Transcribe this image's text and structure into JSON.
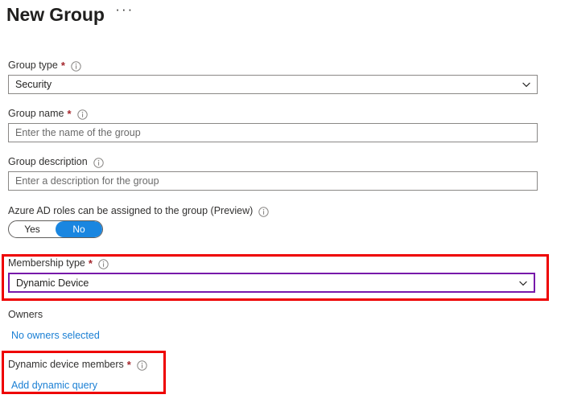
{
  "header": {
    "title": "New Group",
    "more_label": "···"
  },
  "colors": {
    "accent_blue": "#1a86e0",
    "link_blue": "#1a7fd4",
    "required_red": "#a4262c",
    "annotation_red": "#ee0000",
    "focus_purple": "#7719aa",
    "field_border": "#8a8886",
    "text": "#201f1e"
  },
  "form": {
    "group_type": {
      "label": "Group type",
      "required": "*",
      "value": "Security"
    },
    "group_name": {
      "label": "Group name",
      "required": "*",
      "placeholder": "Enter the name of the group",
      "value": ""
    },
    "group_description": {
      "label": "Group description",
      "placeholder": "Enter a description for the group",
      "value": ""
    },
    "azure_ad_roles": {
      "label": "Azure AD roles can be assigned to the group (Preview)",
      "options": [
        "Yes",
        "No"
      ],
      "selected": "No"
    },
    "membership_type": {
      "label": "Membership type",
      "required": "*",
      "value": "Dynamic Device"
    },
    "owners": {
      "label": "Owners",
      "link": "No owners selected"
    },
    "dynamic_device_members": {
      "label": "Dynamic device members",
      "required": "*",
      "link": "Add dynamic query"
    }
  }
}
